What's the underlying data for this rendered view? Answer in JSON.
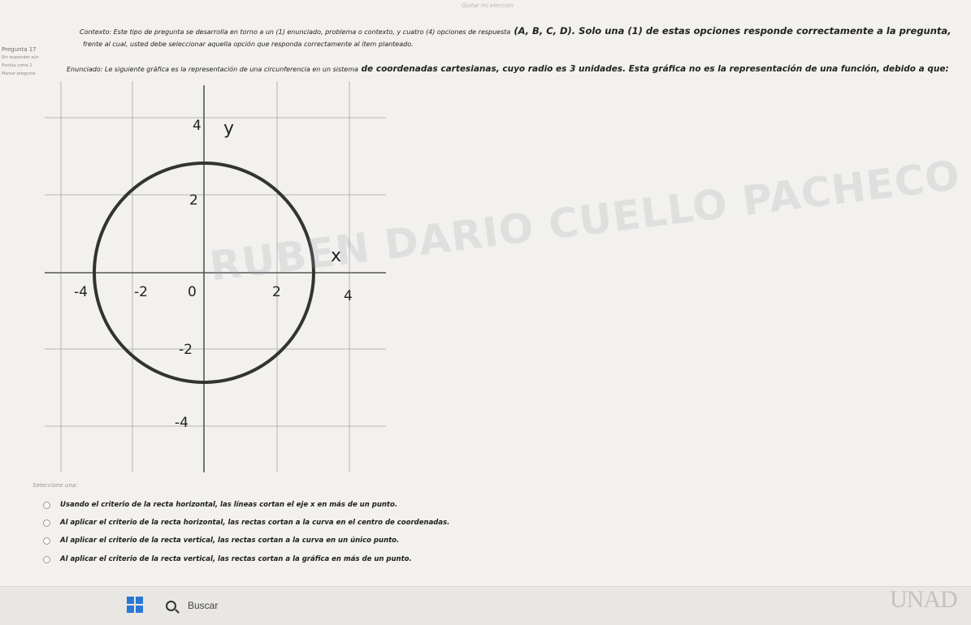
{
  "top_link": "Quitar mi elección",
  "side_panel": {
    "question_number": "Pregunta 17",
    "status": "Sin responder aún",
    "score": "Puntúa como 1",
    "flag": "Marcar pregunta"
  },
  "context": {
    "line1_normal": "Contexto: Este tipo de pregunta se desarrolla en torno a un (1) enunciado, problema o contexto, y cuatro (4) opciones de respuesta",
    "line1_bold": " (A, B, C, D). Solo una (1) de estas opciones responde correctamente a la pregunta,",
    "line2": "frente al cual, usted debe seleccionar aquella opción que responda correctamente al ítem planteado."
  },
  "statement": {
    "normal": "Enunciado: Le siguiente gráfica es la representación de una circunferencia en un sistema",
    "bold": " de coordenadas cartesianas, cuyo radio es 3 unidades. Esta gráfica no es la representación de una función, debido a que:"
  },
  "graph": {
    "x_axis_label": "x",
    "y_axis_label": "y",
    "x_ticks": [
      "-4",
      "-2",
      "0",
      "2",
      "4"
    ],
    "y_ticks": [
      "4",
      "2",
      "-2",
      "-4"
    ],
    "radius": 3
  },
  "watermark": "RUBEN DARIO CUELLO PACHECO",
  "options_title": "Seleccione una:",
  "options": [
    "Usando el criterio de la recta horizontal, las líneas cortan el eje x en más de un punto.",
    "Al aplicar el criterio de la recta horizontal, las rectas cortan a la curva en el centro de coordenadas.",
    "Al aplicar el criterio de la recta vertical, las rectas cortan a la curva en un único punto.",
    "Al aplicar el criterio de la recta vertical, las rectas cortan a la gráfica en más de un punto."
  ],
  "taskbar": {
    "search_text": "Buscar"
  },
  "logo_text": "UNAD",
  "colors": {
    "background": "#f3f1ee",
    "grid": "#b5b5b5",
    "circle": "#333333",
    "windows_blue": "#2b77d6"
  }
}
